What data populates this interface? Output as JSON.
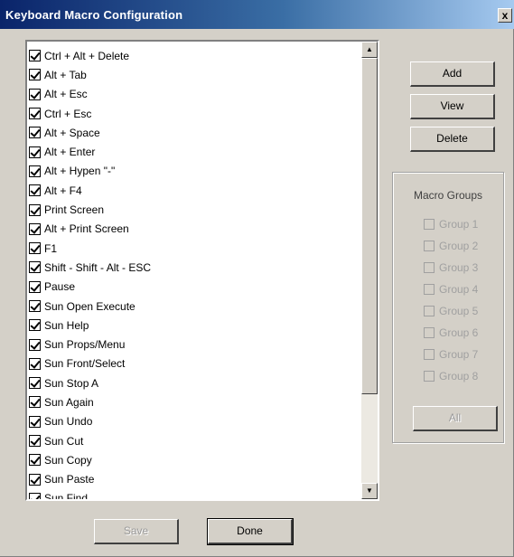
{
  "window": {
    "title": "Keyboard Macro Configuration",
    "close_label": "x"
  },
  "macro_list": {
    "items": [
      "Ctrl + Alt + Delete",
      "Alt + Tab",
      "Alt + Esc",
      "Ctrl + Esc",
      "Alt + Space",
      "Alt + Enter",
      "Alt + Hypen \"-\"",
      "Alt + F4",
      "Print Screen",
      "Alt + Print Screen",
      "F1",
      "Shift - Shift - Alt - ESC",
      "Pause",
      "Sun Open Execute",
      "Sun Help",
      "Sun Props/Menu",
      "Sun Front/Select",
      "Sun Stop A",
      "Sun Again",
      "Sun Undo",
      "Sun Cut",
      "Sun Copy",
      "Sun Paste",
      "Sun Find"
    ]
  },
  "buttons": {
    "add": {
      "label": "Add"
    },
    "view": {
      "label": "View"
    },
    "delete": {
      "label": "Delete"
    },
    "save": {
      "label": "Save"
    },
    "done": {
      "label": "Done"
    },
    "all": {
      "label": "All"
    }
  },
  "macro_groups": {
    "title": "Macro Groups",
    "items": [
      "Group 1",
      "Group 2",
      "Group 3",
      "Group 4",
      "Group 5",
      "Group 6",
      "Group 7",
      "Group 8"
    ]
  }
}
